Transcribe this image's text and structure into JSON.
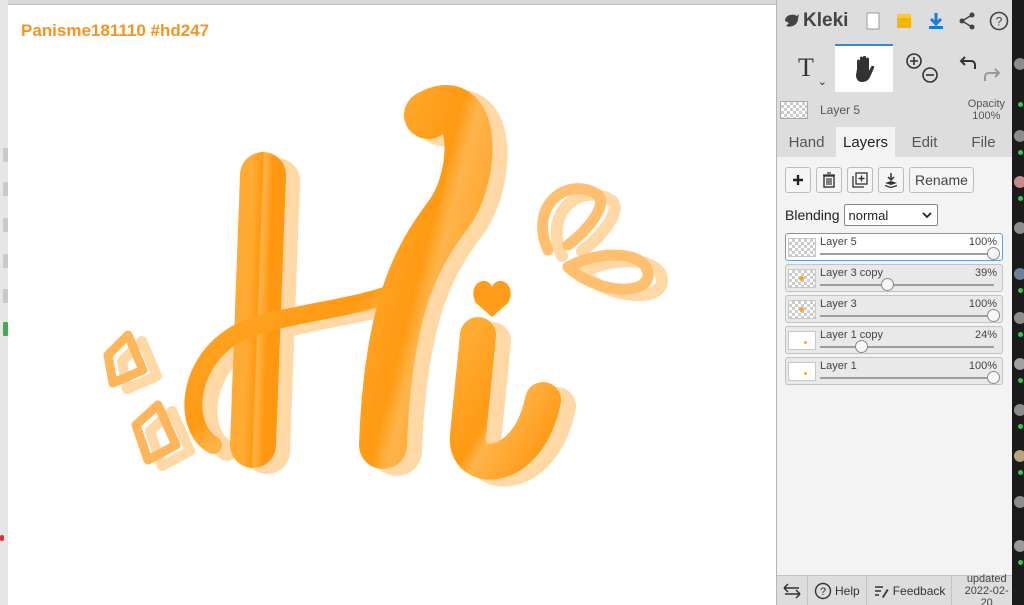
{
  "canvas": {
    "title": "Panisme181110 #hd247",
    "title_color": "#f7941d",
    "art_colors": {
      "main": "#ff9d1a",
      "light": "#ffcd85",
      "shadow": "#ffd7a3"
    }
  },
  "app": {
    "name": "Kleki",
    "top_icons": [
      "new-page-icon",
      "save-icon",
      "download-icon",
      "share-icon",
      "help-icon"
    ]
  },
  "toolbar": {
    "text_tool_label": "T",
    "tools": [
      "text-tool",
      "hand-tool",
      "zoom-tools",
      "undo-redo-tools"
    ],
    "active_tool": "hand-tool"
  },
  "current_layer": {
    "name": "Layer 5",
    "opacity_label": "Opacity",
    "opacity_value": "100%"
  },
  "tabs": [
    {
      "label": "Hand"
    },
    {
      "label": "Layers"
    },
    {
      "label": "Edit"
    },
    {
      "label": "File"
    }
  ],
  "active_tab": "Layers",
  "layer_actions": {
    "rename_label": "Rename"
  },
  "blending": {
    "label": "Blending",
    "value": "normal"
  },
  "layers": [
    {
      "name": "Layer 5",
      "opacity": "100%",
      "opacity_fraction": 1.0,
      "selected": true,
      "thumb": "checker"
    },
    {
      "name": "Layer 3 copy",
      "opacity": "39%",
      "opacity_fraction": 0.39,
      "selected": false,
      "thumb": "checker-dot"
    },
    {
      "name": "Layer 3",
      "opacity": "100%",
      "opacity_fraction": 1.0,
      "selected": false,
      "thumb": "checker-dot"
    },
    {
      "name": "Layer 1 copy",
      "opacity": "24%",
      "opacity_fraction": 0.24,
      "selected": false,
      "thumb": "white-dots"
    },
    {
      "name": "Layer 1",
      "opacity": "100%",
      "opacity_fraction": 1.0,
      "selected": false,
      "thumb": "white-dots"
    }
  ],
  "bottom_bar": {
    "help_label": "Help",
    "feedback_label": "Feedback",
    "updated_label": "updated",
    "updated_date": "2022-02-20"
  },
  "colors": {
    "accent_blue": "#3b86d6",
    "save_yellow": "#f5b400",
    "download_blue": "#1e7ad6"
  }
}
